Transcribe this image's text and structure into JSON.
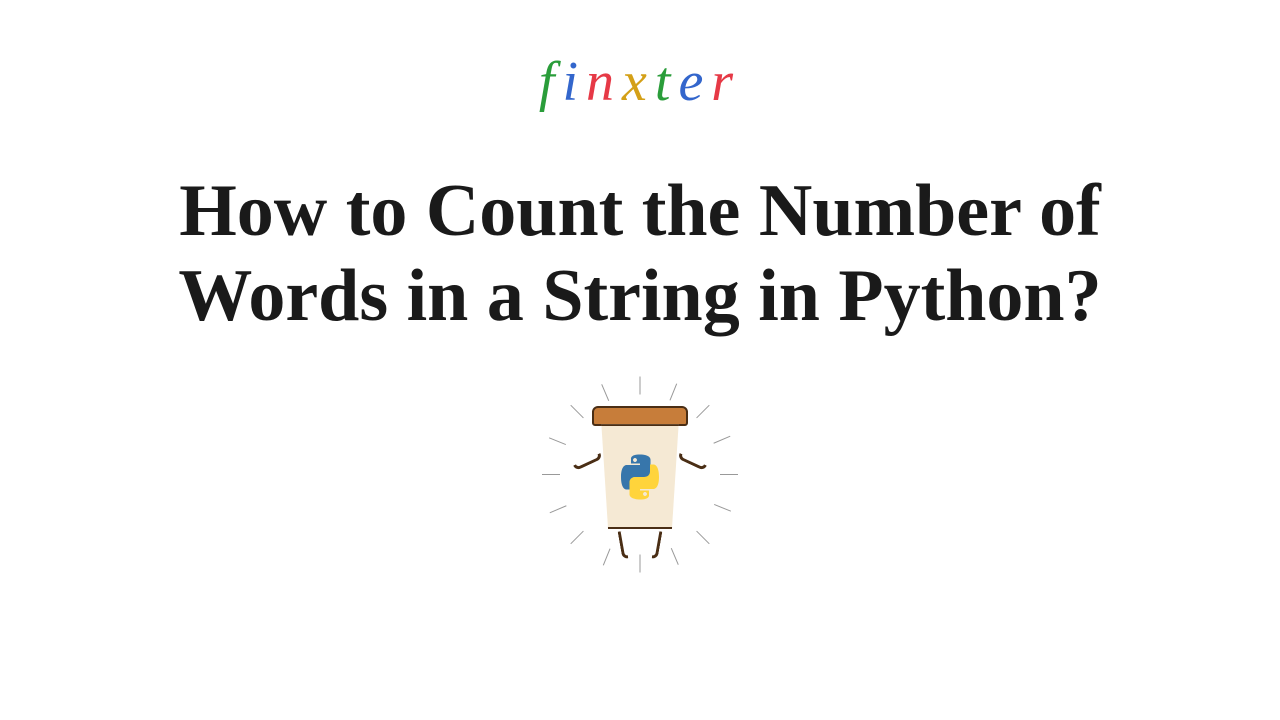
{
  "logo": {
    "letters": [
      "f",
      "i",
      "n",
      "x",
      "t",
      "e",
      "r"
    ]
  },
  "title": "How to Count the Number of Words in a String in Python?",
  "mascot": {
    "icon_name": "python-coffee-cup"
  }
}
